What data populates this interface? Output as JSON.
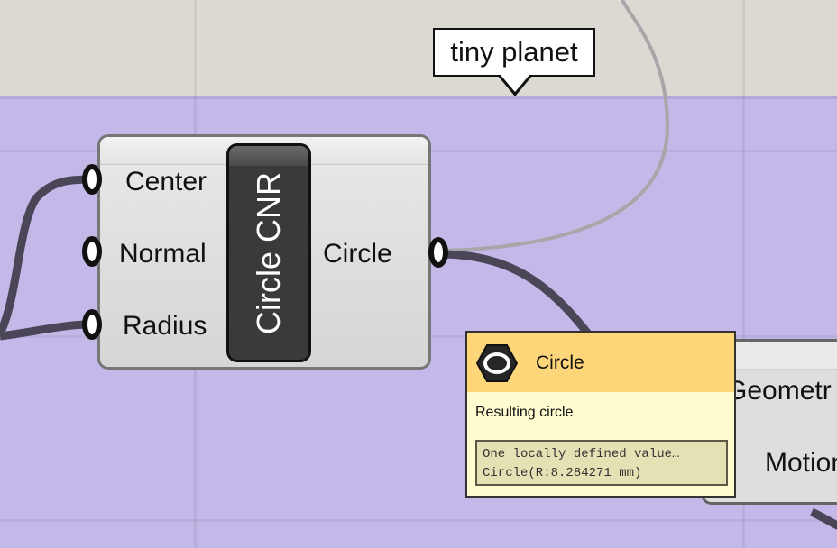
{
  "scribble": {
    "text": "tiny planet"
  },
  "component": {
    "nickname": "Circle CNR",
    "inputs": [
      {
        "label": "Center"
      },
      {
        "label": "Normal"
      },
      {
        "label": "Radius"
      }
    ],
    "outputs": [
      {
        "label": "Circle"
      }
    ]
  },
  "right_component": {
    "input_label": "Geometr",
    "output_label": "Motion"
  },
  "tooltip": {
    "icon": "circle-param-icon",
    "title": "Circle",
    "description": "Resulting circle",
    "data_lines": [
      "One locally defined value…",
      "Circle(R:8.284271 mm)"
    ]
  },
  "colors": {
    "canvas": "#dcd9d3",
    "group": "#c4b8e8",
    "tooltip_header": "#fed67a",
    "tooltip_body": "#fffccf",
    "wire": "#4a4658"
  }
}
